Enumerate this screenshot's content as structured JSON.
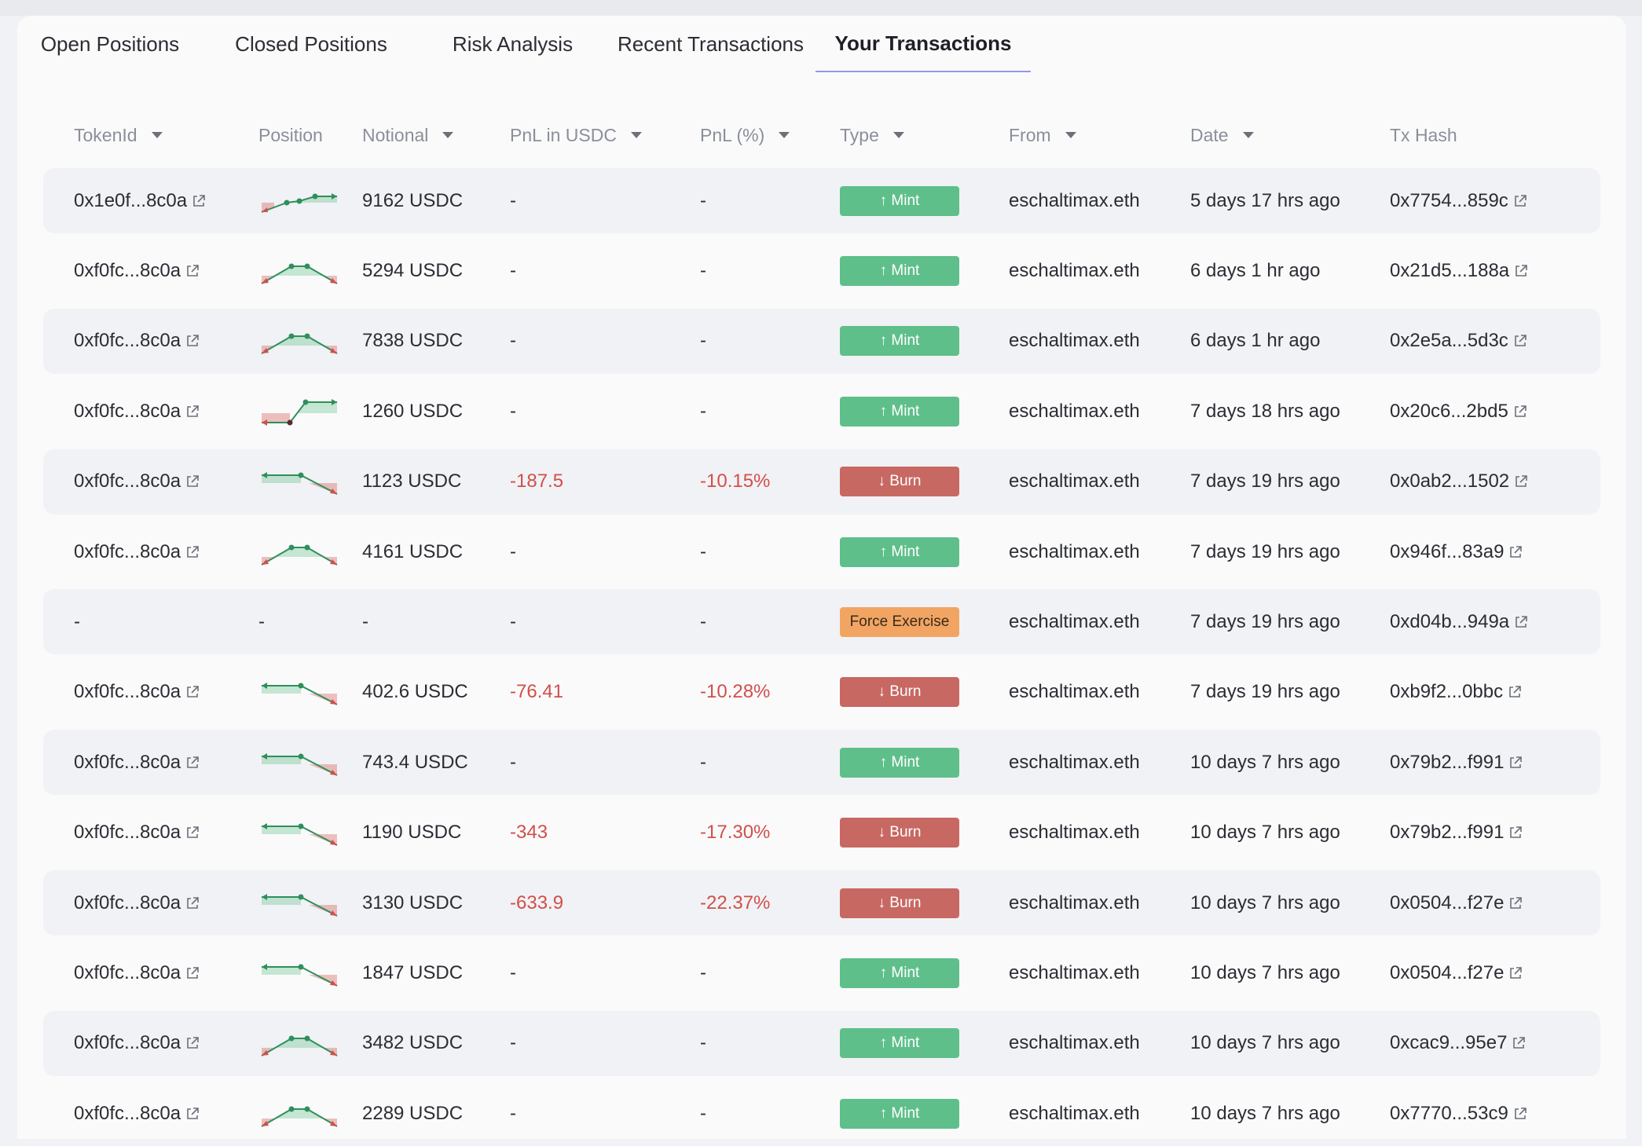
{
  "tabs": [
    {
      "label": "Open Positions",
      "active": false
    },
    {
      "label": "Closed Positions",
      "active": false
    },
    {
      "label": "Risk Analysis",
      "active": false
    },
    {
      "label": "Recent Transactions",
      "active": false
    },
    {
      "label": "Your Transactions",
      "active": true
    }
  ],
  "columns": [
    {
      "key": "token",
      "label": "TokenId",
      "sortable": true
    },
    {
      "key": "position",
      "label": "Position",
      "sortable": false
    },
    {
      "key": "notional",
      "label": "Notional",
      "sortable": true
    },
    {
      "key": "pnl_usdc",
      "label": "PnL in USDC",
      "sortable": true
    },
    {
      "key": "pnl_pct",
      "label": "PnL (%)",
      "sortable": true
    },
    {
      "key": "type",
      "label": "Type",
      "sortable": true
    },
    {
      "key": "from",
      "label": "From",
      "sortable": true
    },
    {
      "key": "date",
      "label": "Date",
      "sortable": true
    },
    {
      "key": "tx",
      "label": "Tx Hash",
      "sortable": false
    }
  ],
  "colors": {
    "mint": "#5fbf8a",
    "burn": "#c86862",
    "force": "#f2a563",
    "negative": "#d14f4a",
    "active_tab_underline": "#8f9be6"
  },
  "icons": {
    "token_link": "external-link-icon",
    "tx_link": "external-link-icon",
    "sort": "caret-down-icon"
  },
  "rows": [
    {
      "token": "0x1e0f...8c0a",
      "spark": "rise",
      "notional": "9162 USDC",
      "pnl_usdc": "-",
      "pnl_pct": "-",
      "type": "Mint",
      "type_label": "↑ Mint",
      "from": "eschaltimax.eth",
      "date": "5 days 17 hrs ago",
      "tx": "0x7754...859c"
    },
    {
      "token": "0xf0fc...8c0a",
      "spark": "hump",
      "notional": "5294 USDC",
      "pnl_usdc": "-",
      "pnl_pct": "-",
      "type": "Mint",
      "type_label": "↑ Mint",
      "from": "eschaltimax.eth",
      "date": "6 days 1 hr ago",
      "tx": "0x21d5...188a"
    },
    {
      "token": "0xf0fc...8c0a",
      "spark": "hump",
      "notional": "7838 USDC",
      "pnl_usdc": "-",
      "pnl_pct": "-",
      "type": "Mint",
      "type_label": "↑ Mint",
      "from": "eschaltimax.eth",
      "date": "6 days 1 hr ago",
      "tx": "0x2e5a...5d3c"
    },
    {
      "token": "0xf0fc...8c0a",
      "spark": "call",
      "notional": "1260 USDC",
      "pnl_usdc": "-",
      "pnl_pct": "-",
      "type": "Mint",
      "type_label": "↑ Mint",
      "from": "eschaltimax.eth",
      "date": "7 days 18 hrs ago",
      "tx": "0x20c6...2bd5"
    },
    {
      "token": "0xf0fc...8c0a",
      "spark": "put",
      "notional": "1123 USDC",
      "pnl_usdc": "-187.5",
      "pnl_pct": "-10.15%",
      "type": "Burn",
      "type_label": "↓ Burn",
      "from": "eschaltimax.eth",
      "date": "7 days 19 hrs ago",
      "tx": "0x0ab2...1502"
    },
    {
      "token": "0xf0fc...8c0a",
      "spark": "hump",
      "notional": "4161 USDC",
      "pnl_usdc": "-",
      "pnl_pct": "-",
      "type": "Mint",
      "type_label": "↑ Mint",
      "from": "eschaltimax.eth",
      "date": "7 days 19 hrs ago",
      "tx": "0x946f...83a9"
    },
    {
      "token": "-",
      "spark": "none",
      "position_text": "-",
      "notional": "-",
      "pnl_usdc": "-",
      "pnl_pct": "-",
      "type": "Force",
      "type_label": "Force Exercise",
      "from": "eschaltimax.eth",
      "date": "7 days 19 hrs ago",
      "tx": "0xd04b...949a"
    },
    {
      "token": "0xf0fc...8c0a",
      "spark": "put",
      "notional": "402.6 USDC",
      "pnl_usdc": "-76.41",
      "pnl_pct": "-10.28%",
      "type": "Burn",
      "type_label": "↓ Burn",
      "from": "eschaltimax.eth",
      "date": "7 days 19 hrs ago",
      "tx": "0xb9f2...0bbc"
    },
    {
      "token": "0xf0fc...8c0a",
      "spark": "put",
      "notional": "743.4 USDC",
      "pnl_usdc": "-",
      "pnl_pct": "-",
      "type": "Mint",
      "type_label": "↑ Mint",
      "from": "eschaltimax.eth",
      "date": "10 days 7 hrs ago",
      "tx": "0x79b2...f991"
    },
    {
      "token": "0xf0fc...8c0a",
      "spark": "put",
      "notional": "1190 USDC",
      "pnl_usdc": "-343",
      "pnl_pct": "-17.30%",
      "type": "Burn",
      "type_label": "↓ Burn",
      "from": "eschaltimax.eth",
      "date": "10 days 7 hrs ago",
      "tx": "0x79b2...f991"
    },
    {
      "token": "0xf0fc...8c0a",
      "spark": "put",
      "notional": "3130 USDC",
      "pnl_usdc": "-633.9",
      "pnl_pct": "-22.37%",
      "type": "Burn",
      "type_label": "↓ Burn",
      "from": "eschaltimax.eth",
      "date": "10 days 7 hrs ago",
      "tx": "0x0504...f27e"
    },
    {
      "token": "0xf0fc...8c0a",
      "spark": "put",
      "notional": "1847 USDC",
      "pnl_usdc": "-",
      "pnl_pct": "-",
      "type": "Mint",
      "type_label": "↑ Mint",
      "from": "eschaltimax.eth",
      "date": "10 days 7 hrs ago",
      "tx": "0x0504...f27e"
    },
    {
      "token": "0xf0fc...8c0a",
      "spark": "hump",
      "notional": "3482 USDC",
      "pnl_usdc": "-",
      "pnl_pct": "-",
      "type": "Mint",
      "type_label": "↑ Mint",
      "from": "eschaltimax.eth",
      "date": "10 days 7 hrs ago",
      "tx": "0xcac9...95e7"
    },
    {
      "token": "0xf0fc...8c0a",
      "spark": "hump",
      "notional": "2289 USDC",
      "pnl_usdc": "-",
      "pnl_pct": "-",
      "type": "Mint",
      "type_label": "↑ Mint",
      "from": "eschaltimax.eth",
      "date": "10 days 7 hrs ago",
      "tx": "0x7770...53c9"
    }
  ]
}
